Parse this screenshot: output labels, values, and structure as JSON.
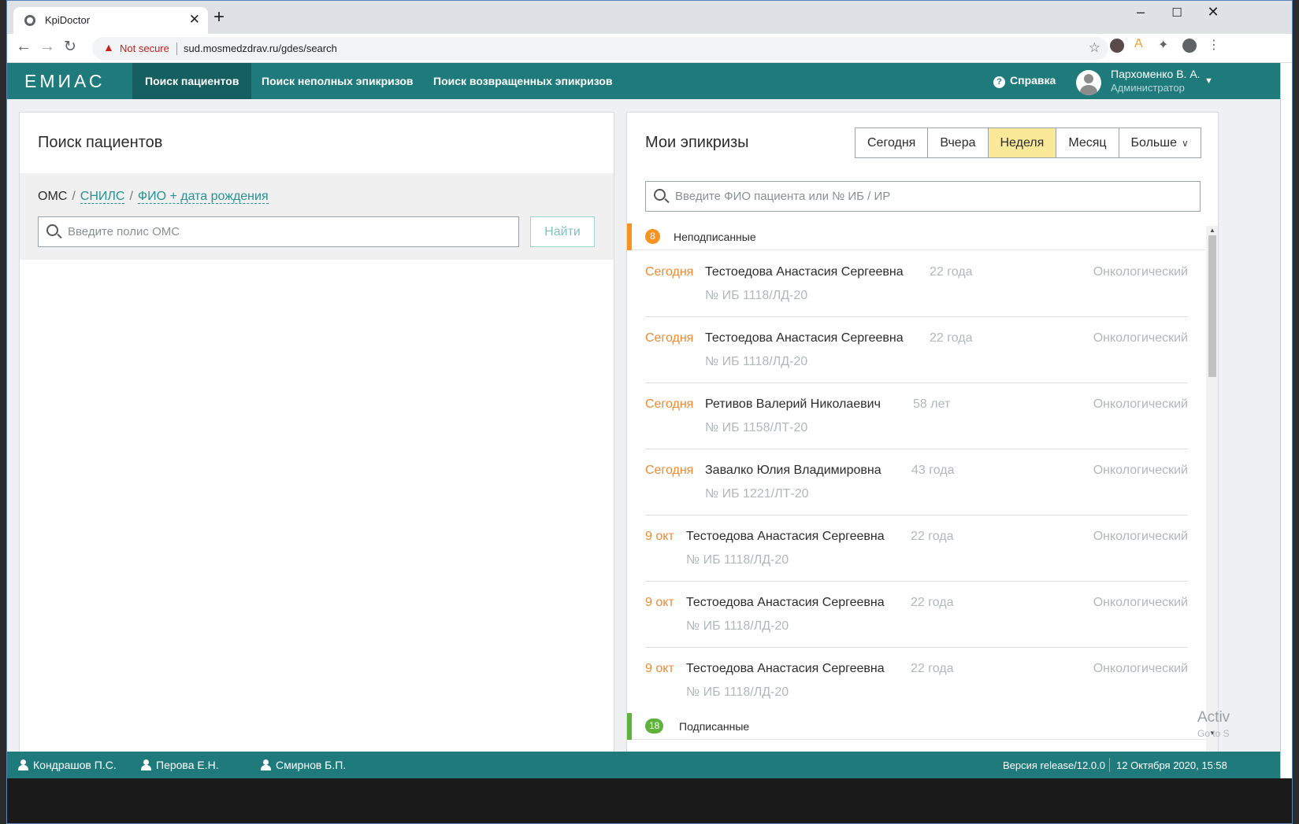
{
  "browser": {
    "tab_title": "KpiDoctor",
    "security_label": "Not secure",
    "url": "sud.mosmedzdrav.ru/gdes/search"
  },
  "app": {
    "logo": "ЕМИАС",
    "nav": [
      {
        "label": "Поиск пациентов"
      },
      {
        "label": "Поиск неполных эпикризов"
      },
      {
        "label": "Поиск возвращенных эпикризов"
      }
    ],
    "help_label": "Справка",
    "user_name": "Пархоменко В. А.",
    "user_role": "Администратор",
    "accent_color": "#1f7a7b"
  },
  "search_panel": {
    "title": "Поиск пациентов",
    "modes": [
      "ОМС",
      "СНИЛС",
      "ФИО + дата рождения"
    ],
    "input_placeholder": "Введите полис ОМС",
    "find_button": "Найти"
  },
  "epicrisis_panel": {
    "title": "Мои эпикризы",
    "periods": [
      "Сегодня",
      "Вчера",
      "Неделя",
      "Месяц",
      "Больше"
    ],
    "selected_period": "Неделя",
    "search_placeholder": "Введите ФИО пациента или № ИБ / ИР",
    "groups": [
      {
        "count": "8",
        "label": "Неподписанные",
        "color": "#f7931e"
      },
      {
        "count": "18",
        "label": "Подписанные",
        "color": "#5fb33b"
      }
    ],
    "rows": [
      {
        "date": "Сегодня",
        "name": "Тестоедова Анастасия Сергеевна",
        "age": "22 года",
        "dept": "Онкологический",
        "ib": "№ ИБ 1118/ЛД-20"
      },
      {
        "date": "Сегодня",
        "name": "Тестоедова Анастасия Сергеевна",
        "age": "22 года",
        "dept": "Онкологический",
        "ib": "№ ИБ 1118/ЛД-20"
      },
      {
        "date": "Сегодня",
        "name": "Ретивов Валерий Николаевич",
        "age": "58 лет",
        "dept": "Онкологический",
        "ib": "№ ИБ 1158/ЛТ-20"
      },
      {
        "date": "Сегодня",
        "name": "Завалко Юлия Владимировна",
        "age": "43 года",
        "dept": "Онкологический",
        "ib": "№ ИБ 1221/ЛТ-20"
      },
      {
        "date": "9 окт",
        "name": "Тестоедова Анастасия Сергеевна",
        "age": "22 года",
        "dept": "Онкологический",
        "ib": "№ ИБ 1118/ЛД-20"
      },
      {
        "date": "9 окт",
        "name": "Тестоедова Анастасия Сергеевна",
        "age": "22 года",
        "dept": "Онкологический",
        "ib": "№ ИБ 1118/ЛД-20"
      },
      {
        "date": "9 окт",
        "name": "Тестоедова Анастасия Сергеевна",
        "age": "22 года",
        "dept": "Онкологический",
        "ib": "№ ИБ 1118/ЛД-20"
      }
    ]
  },
  "footer": {
    "users": [
      "Кондрашов П.С.",
      "Перова Е.Н.",
      "Смирнов Б.П."
    ],
    "version": "Версия release/12.0.0",
    "datetime": "12 Октября 2020, 15:58"
  },
  "os_overlay": {
    "line1": "Activ",
    "line2": "Go to S"
  }
}
